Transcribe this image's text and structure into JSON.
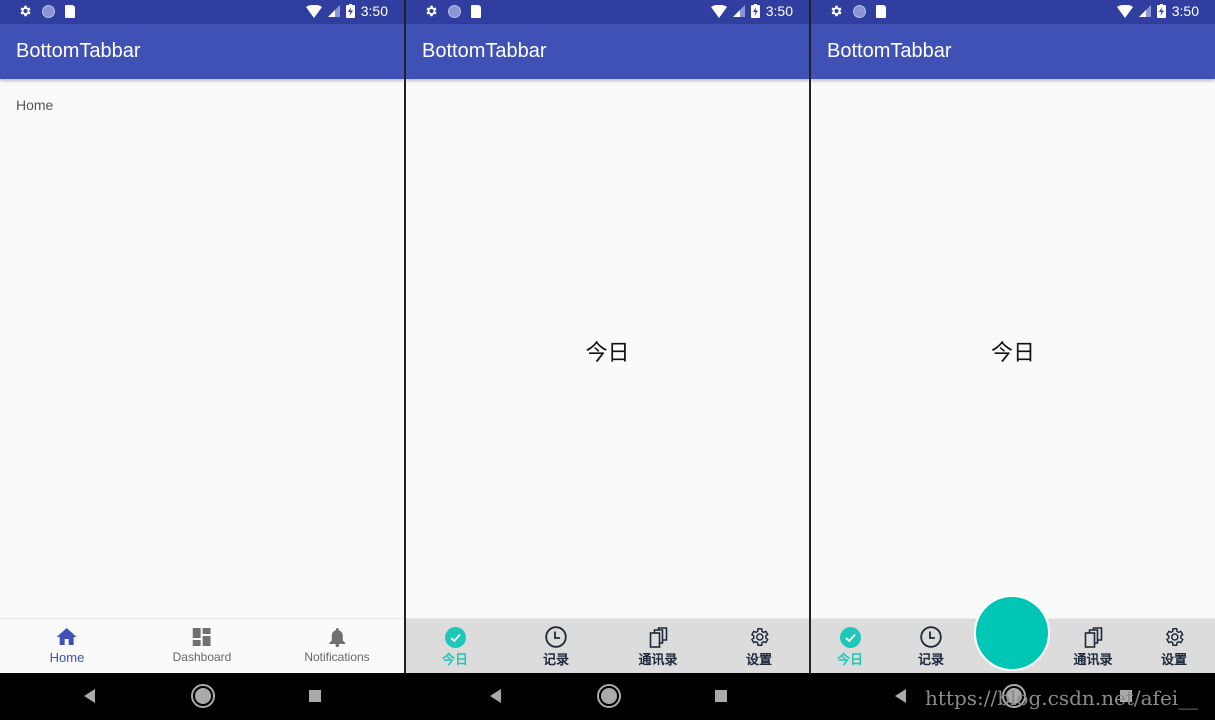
{
  "status_bar": {
    "time": "3:50"
  },
  "screens": [
    {
      "app_title": "BottomTabbar",
      "content_text": "Home",
      "nav": [
        {
          "label": "Home",
          "icon": "home-icon",
          "active": true
        },
        {
          "label": "Dashboard",
          "icon": "dashboard-icon",
          "active": false
        },
        {
          "label": "Notifications",
          "icon": "bell-icon",
          "active": false
        }
      ]
    },
    {
      "app_title": "BottomTabbar",
      "content_text": "今日",
      "nav": [
        {
          "label": "今日",
          "icon": "check-circle-icon",
          "active": true
        },
        {
          "label": "记录",
          "icon": "clock-icon",
          "active": false
        },
        {
          "label": "通讯录",
          "icon": "copy-icon",
          "active": false
        },
        {
          "label": "设置",
          "icon": "gear-icon",
          "active": false
        }
      ]
    },
    {
      "app_title": "BottomTabbar",
      "content_text": "今日",
      "nav": [
        {
          "label": "今日",
          "icon": "check-circle-icon",
          "active": true
        },
        {
          "label": "记录",
          "icon": "clock-icon",
          "active": false
        },
        {
          "label": "通讯录",
          "icon": "copy-icon",
          "active": false
        },
        {
          "label": "设置",
          "icon": "gear-icon",
          "active": false
        }
      ]
    }
  ],
  "colors": {
    "primary": "#3f51b5",
    "primary_dark": "#303f9f",
    "accent": "#00c7b5",
    "tab_bar": "#dcdcdc"
  },
  "watermark": "https://blog.csdn.net/afei__"
}
